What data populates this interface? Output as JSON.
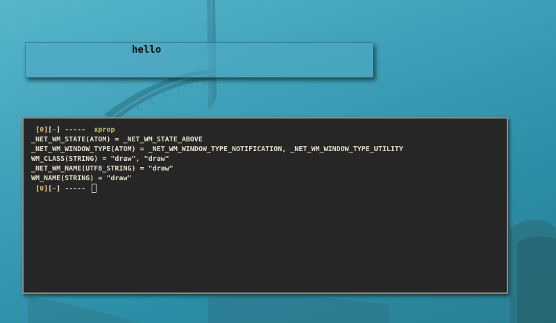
{
  "notification": {
    "text": "hello"
  },
  "terminal": {
    "prompt1": {
      "open": "[",
      "num": "0",
      "sep": "][",
      "dir": "~",
      "close": "]",
      "dashes": " -----",
      "command": "xprop"
    },
    "output": [
      "_NET_WM_STATE(ATOM) = _NET_WM_STATE_ABOVE",
      "_NET_WM_WINDOW_TYPE(ATOM) = _NET_WM_WINDOW_TYPE_NOTIFICATION, _NET_WM_WINDOW_TYPE_UTILITY",
      "WM_CLASS(STRING) = \"draw\", \"draw\"",
      "_NET_WM_NAME(UTF8_STRING) = \"draw\"",
      "WM_NAME(STRING) = \"draw\""
    ],
    "prompt2": {
      "open": "[",
      "num": "0",
      "sep": "][",
      "dir": "~",
      "close": "]",
      "dashes": " -----"
    }
  },
  "colors": {
    "terminal_bg": "#262626",
    "terminal_fg": "#e8dfc7",
    "prompt_number": "#e7b14d",
    "prompt_dir": "#9ba55d",
    "command": "#c8c640",
    "terminal_border": "#8d8b7d"
  }
}
